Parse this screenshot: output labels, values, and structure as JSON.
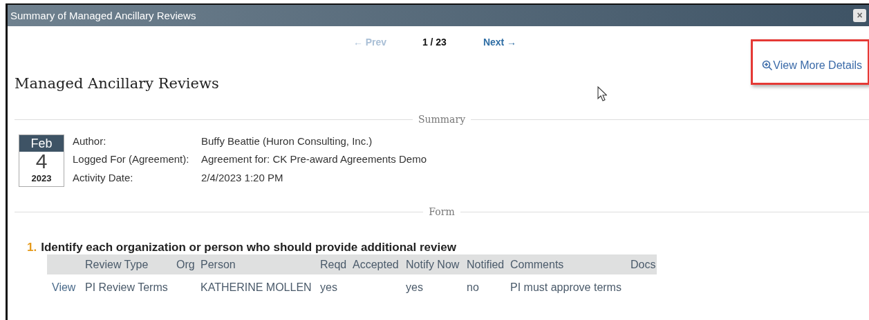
{
  "window": {
    "title": "Summary of Managed Ancillary Reviews",
    "close": "×"
  },
  "pager": {
    "prev": "← Prev",
    "position": "1 / 23",
    "next": "Next →",
    "prev_disabled": true
  },
  "details_link": {
    "label": "View More Details",
    "highlighted": true
  },
  "heading": "Managed Ancillary Reviews",
  "summary": {
    "divider": "Summary",
    "date": {
      "month": "Feb",
      "day": "4",
      "year": "2023"
    },
    "fields": [
      {
        "label": "Author:",
        "value": "Buffy Beattie (Huron Consulting, Inc.)"
      },
      {
        "label": "Logged For (Agreement):",
        "value": "Agreement for: CK Pre-award Agreements Demo"
      },
      {
        "label": "Activity Date:",
        "value": "2/4/2023 1:20 PM"
      }
    ]
  },
  "form": {
    "divider": "Form",
    "questions": [
      {
        "number": "1.",
        "text": "Identify each organization or person who should provide additional review",
        "table": {
          "columns": [
            "Review Type",
            "Org",
            "Person",
            "Reqd",
            "Accepted",
            "Notify Now",
            "Notified",
            "Comments",
            "Docs"
          ],
          "rows": [
            {
              "action": "View",
              "cells": [
                "PI Review Terms",
                null,
                "KATHERINE MOLLEN",
                "yes",
                null,
                "yes",
                "no",
                "PI must approve terms",
                null
              ]
            }
          ]
        }
      }
    ]
  }
}
